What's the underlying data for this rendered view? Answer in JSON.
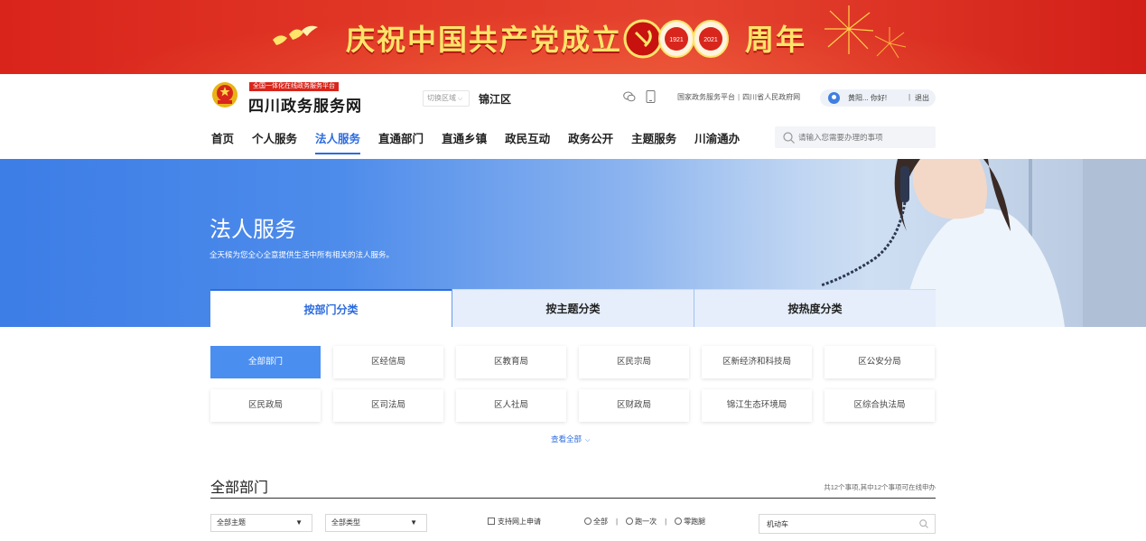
{
  "banner": {
    "slogan": "庆祝中国共产党成立",
    "hundred": "100",
    "years": [
      "1921",
      "2021"
    ],
    "suffix": "周年",
    "colors": {
      "background": "#d9241c",
      "text": "#ffe46a"
    }
  },
  "site": {
    "tagline": "全国一体化在线政务服务平台",
    "name": "四川政务服务网",
    "region_switch_label": "切换区域",
    "region_name": "锦江区",
    "emblem_icon": "national-emblem-icon"
  },
  "top_links": {
    "national_platform": "国家政务服务平台",
    "provincial_gov": "四川省人民政府网",
    "separator": "|"
  },
  "user": {
    "greeting": "黄阳... 你好!",
    "divider": "|",
    "logout": "退出"
  },
  "nav": {
    "items": [
      {
        "label": "首页"
      },
      {
        "label": "个人服务"
      },
      {
        "label": "法人服务",
        "active": true
      },
      {
        "label": "直通部门"
      },
      {
        "label": "直通乡镇"
      },
      {
        "label": "政民互动"
      },
      {
        "label": "政务公开"
      },
      {
        "label": "主题服务"
      },
      {
        "label": "川渝通办"
      }
    ]
  },
  "search": {
    "placeholder": "请输入您需要办理的事项"
  },
  "hero": {
    "title": "法人服务",
    "subtitle": "全天候为您全心全意提供生活中所有相关的法人服务。",
    "accent_color": "#3c7de6"
  },
  "tabs": [
    {
      "label": "按部门分类",
      "active": true
    },
    {
      "label": "按主题分类"
    },
    {
      "label": "按热度分类"
    }
  ],
  "departments": [
    {
      "label": "全部部门",
      "active": true
    },
    {
      "label": "区经信局"
    },
    {
      "label": "区教育局"
    },
    {
      "label": "区民宗局"
    },
    {
      "label": "区新经济和科技局"
    },
    {
      "label": "区公安分局"
    },
    {
      "label": "区民政局"
    },
    {
      "label": "区司法局"
    },
    {
      "label": "区人社局"
    },
    {
      "label": "区财政局"
    },
    {
      "label": "锦江生态环境局"
    },
    {
      "label": "区综合执法局"
    }
  ],
  "view_all": "查看全部",
  "section": {
    "title": "全部部门",
    "count_text": "共12个事项,其中12个事项可在线申办"
  },
  "filters": {
    "theme_select": "全部主题",
    "type_select": "全部类型",
    "online_checkbox": "支持网上申请",
    "radio_options": [
      "全部",
      "跑一次",
      "零跑腿"
    ],
    "keyword": "机动车"
  }
}
